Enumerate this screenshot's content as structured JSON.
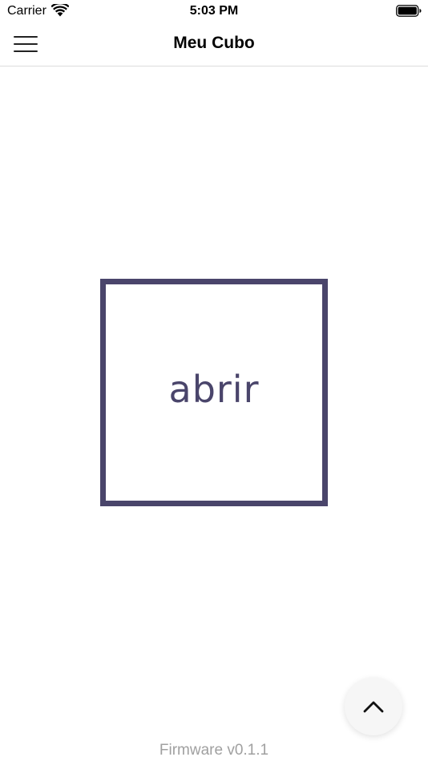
{
  "status_bar": {
    "carrier": "Carrier",
    "time": "5:03 PM",
    "wifi_icon": "wifi-icon",
    "battery_icon": "battery-icon"
  },
  "nav": {
    "title": "Meu Cubo",
    "menu_icon": "hamburger-menu-icon"
  },
  "main": {
    "open_label": "abrir",
    "accent_color": "#4a456b"
  },
  "fab": {
    "icon": "chevron-up-icon"
  },
  "footer": {
    "firmware": "Firmware v0.1.1"
  }
}
